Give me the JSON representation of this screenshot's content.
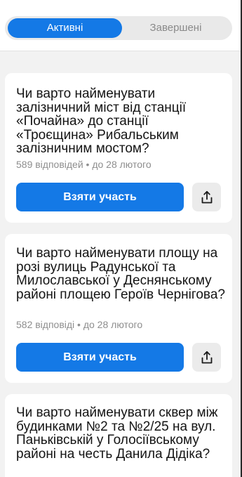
{
  "tabs": {
    "active": "Активні",
    "completed": "Завершені"
  },
  "polls": [
    {
      "title": "Чи варто найменувати залізничний міст від станції «Почайна» до станції «Троєщина» Рибальським залізничним мостом?",
      "meta": "589 відповідей • до 28 лютого",
      "join_label": "Взяти участь",
      "share_icon": "share-icon"
    },
    {
      "title": "Чи варто найменувати площу на розі вулиць Радунської та Милославської у Деснянському районі площею Героїв Чернігова?",
      "meta": "582 відповіді • до 28 лютого",
      "join_label": "Взяти участь",
      "share_icon": "share-icon"
    },
    {
      "title": "Чи варто найменувати сквер між будинками №2 та №2/25 на вул. Паньківській у Голосіївському районі на честь Данила Дідіка?"
    }
  ],
  "colors": {
    "accent": "#1479e6",
    "background": "#f2f2f2",
    "card": "#ffffff",
    "meta_text": "#8e8e8e"
  }
}
